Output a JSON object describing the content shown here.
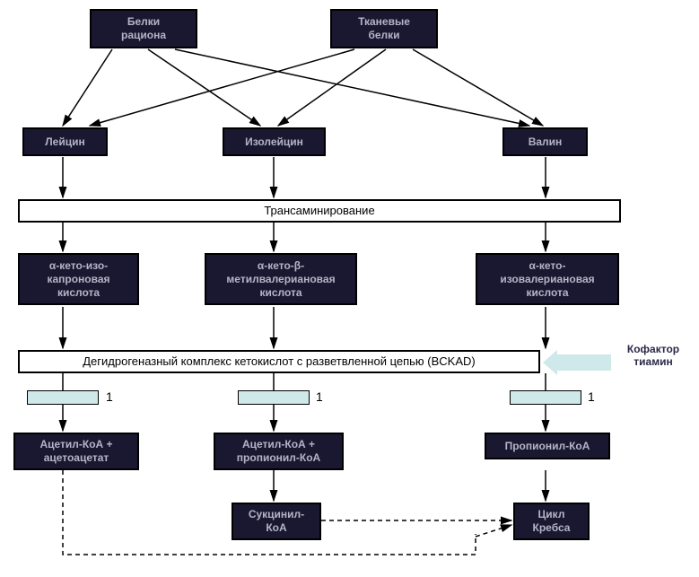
{
  "top": {
    "left": "Белки\nрациона",
    "right": "Тканевые\nбелки"
  },
  "amino": {
    "leu": "Лейцин",
    "ile": "Изолейцин",
    "val": "Валин"
  },
  "trans": "Трансаминирование",
  "keto": {
    "leu": "α-кето-изо-\nкапроновая\nкислота",
    "ile": "α-кето-β-\nметилвалериановая\nкислота",
    "val": "α-кето-\nизовалериановая\nкислота"
  },
  "bckad": "Дегидрогеназный комплекс кетокислот с разветвленной цепью (BCKAD)",
  "cof": "Кофактор\nтиамин",
  "one": "1",
  "coa": {
    "leu": "Ацетил-КоА +\nацетоацетат",
    "ile": "Ацетил-КоА +\nпропионил-КоА",
    "val": "Пропионил-КоА"
  },
  "succ": "Сукцинил-\nКоА",
  "cycle": "Цикл\nКребса"
}
